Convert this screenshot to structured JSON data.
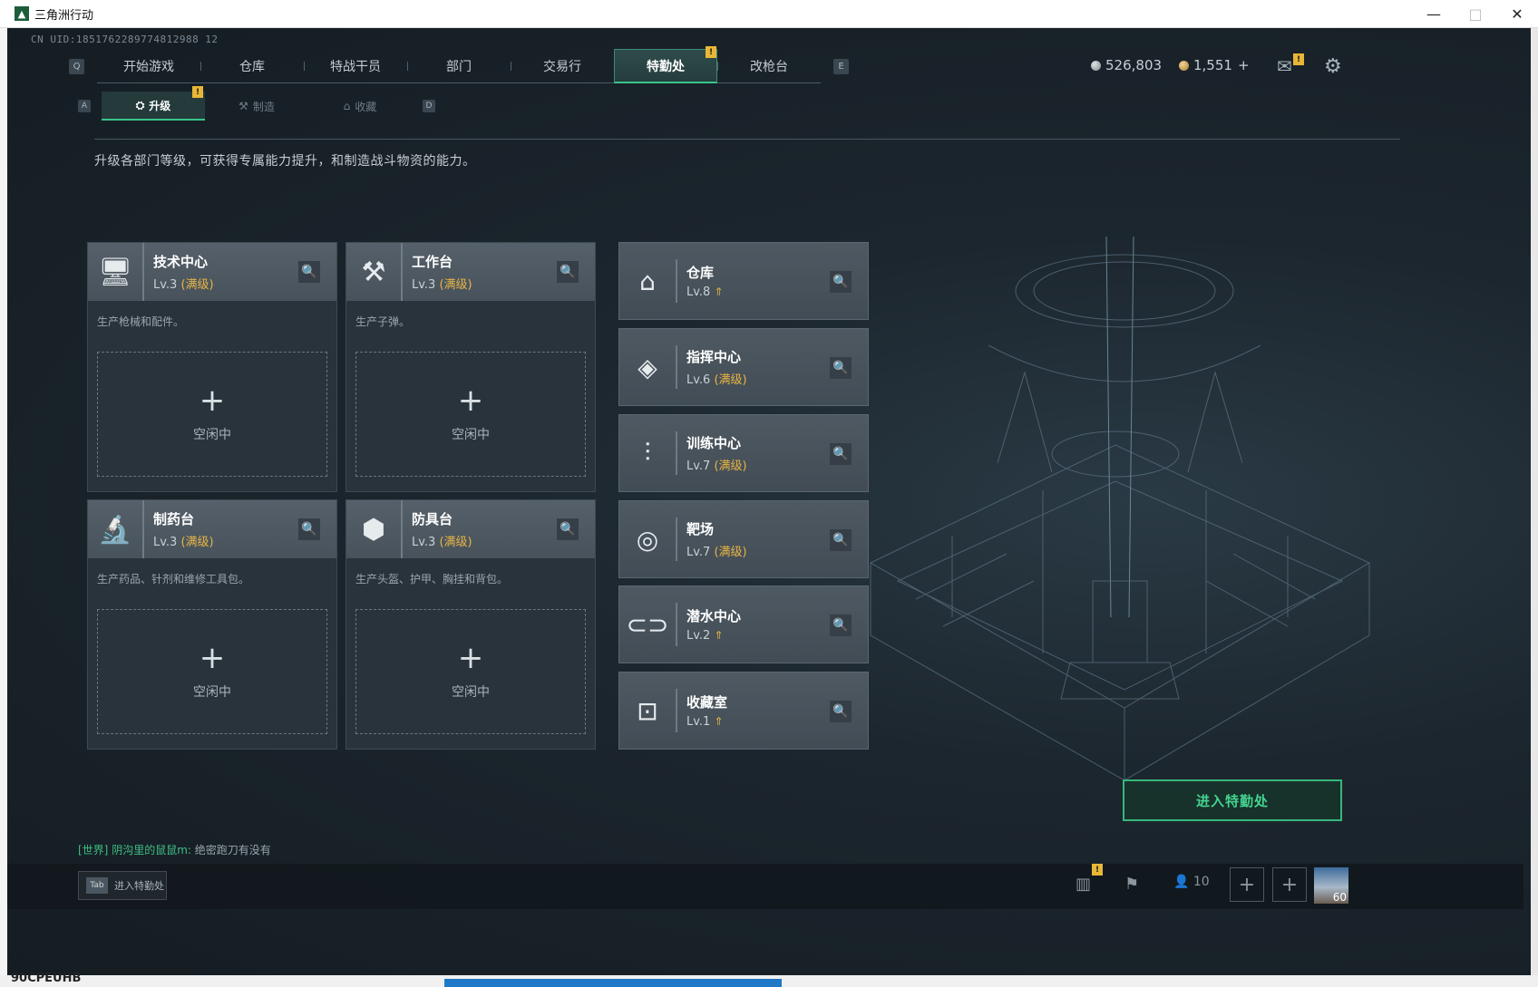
{
  "window": {
    "title": "三角洲行动",
    "controls": [
      "—",
      "□",
      "✕"
    ]
  },
  "uid": "CN UID:1851762289774812988 12",
  "topnav": {
    "left_key": "Q",
    "right_key": "E",
    "tabs": [
      "开始游戏",
      "仓库",
      "特战干员",
      "部门",
      "交易行",
      "特勤处",
      "改枪台"
    ],
    "active": "特勤处",
    "badge": "!"
  },
  "currency": {
    "silver": "526,803",
    "gold": "1,551",
    "gold_add": "+"
  },
  "top_icons": {
    "mail_badge": "!"
  },
  "subnav": {
    "left_key": "A",
    "right_key": "D",
    "tabs": [
      "升级",
      "制造",
      "收藏"
    ],
    "active": "升级",
    "badge": "!"
  },
  "intro": "升级各部门等级，可获得专属能力提升，和制造战斗物资的能力。",
  "big_cards": [
    {
      "name": "技术中心",
      "level": "Lv.3",
      "max": "(满级)",
      "desc": "生产枪械和配件。",
      "slot_plus": "+",
      "slot_status": "空闲中",
      "icon": "monitor-icon"
    },
    {
      "name": "工作台",
      "level": "Lv.3",
      "max": "(满级)",
      "desc": "生产子弹。",
      "slot_plus": "+",
      "slot_status": "空闲中",
      "icon": "tools-icon"
    },
    {
      "name": "制药台",
      "level": "Lv.3",
      "max": "(满级)",
      "desc": "生产药品、针剂和维修工具包。",
      "slot_plus": "+",
      "slot_status": "空闲中",
      "icon": "microscope-icon"
    },
    {
      "name": "防具台",
      "level": "Lv.3",
      "max": "(满级)",
      "desc": "生产头盔、护甲、胸挂和背包。",
      "slot_plus": "+",
      "slot_status": "空闲中",
      "icon": "cubes-icon"
    }
  ],
  "small_cards": [
    {
      "name": "仓库",
      "level": "Lv.8",
      "max": "",
      "up": "⇑",
      "icon": "warehouse-icon"
    },
    {
      "name": "指挥中心",
      "level": "Lv.6",
      "max": "(满级)",
      "up": "",
      "icon": "chip-icon"
    },
    {
      "name": "训练中心",
      "level": "Lv.7",
      "max": "(满级)",
      "up": "",
      "icon": "dumbbell-icon"
    },
    {
      "name": "靶场",
      "level": "Lv.7",
      "max": "(满级)",
      "up": "",
      "icon": "target-icon"
    },
    {
      "name": "潜水中心",
      "level": "Lv.2",
      "max": "",
      "up": "⇑",
      "icon": "diving-mask-icon"
    },
    {
      "name": "收藏室",
      "level": "Lv.1",
      "max": "",
      "up": "⇑",
      "icon": "trophy-case-icon"
    }
  ],
  "enter_button": "进入特勤处",
  "chat": {
    "channel": "[世界]",
    "user": "阴沟里的鼠鼠m:",
    "message": "绝密跑刀有没有"
  },
  "bottom": {
    "tab_key": "Tab",
    "tab_label": "进入特勤处",
    "stats_badge": "!",
    "friends_count": "10",
    "fps": "60"
  },
  "taskbar": {
    "text": "90CPEUHB"
  }
}
